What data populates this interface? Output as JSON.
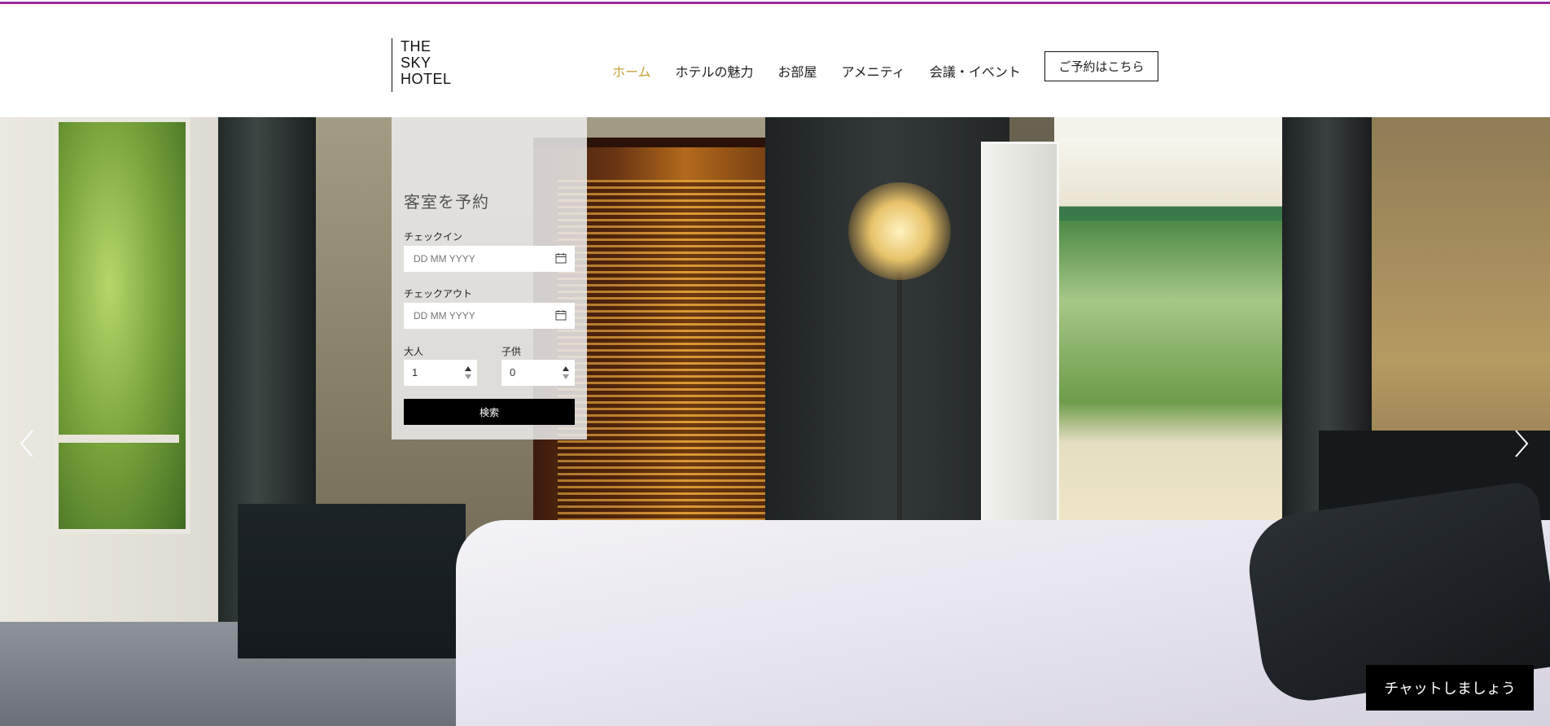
{
  "logo": {
    "lines": [
      "THE",
      "SKY",
      "HOTEL"
    ]
  },
  "nav": {
    "items": [
      {
        "label": "ホーム",
        "active": true
      },
      {
        "label": "ホテルの魅力",
        "active": false
      },
      {
        "label": "お部屋",
        "active": false
      },
      {
        "label": "アメニティ",
        "active": false
      },
      {
        "label": "会議・イベント",
        "active": false
      }
    ],
    "book_button": "ご予約はこちら",
    "active_color": "#c8a23a"
  },
  "accent_bar_color": "#9b2a9e",
  "booking": {
    "title": "客室を予約",
    "checkin_label": "チェックイン",
    "checkin_placeholder": "DD MM YYYY",
    "checkout_label": "チェックアウト",
    "checkout_placeholder": "DD MM YYYY",
    "adults_label": "大人",
    "adults_value": "1",
    "children_label": "子供",
    "children_value": "0",
    "search_button": "検索"
  },
  "hero": {
    "prev_icon": "chevron-left-icon",
    "next_icon": "chevron-right-icon"
  },
  "chat_button": "チャットしましょう"
}
